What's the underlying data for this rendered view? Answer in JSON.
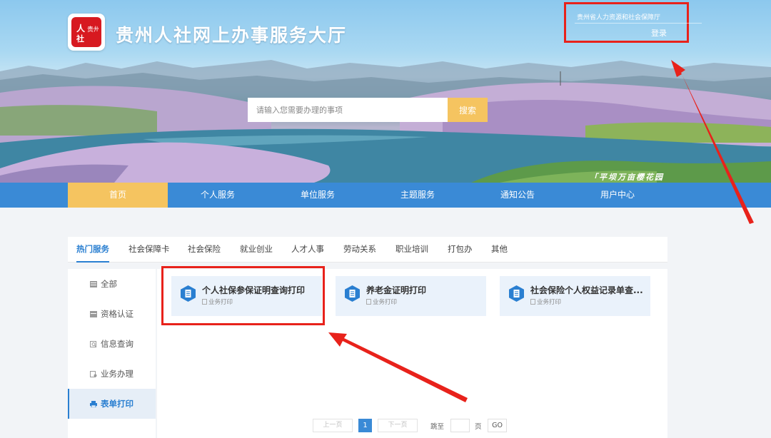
{
  "header": {
    "logo_text": "贵州",
    "site_title": "贵州人社网上办事服务大厅",
    "department": "贵州省人力资源和社会保障厅",
    "login_label": "登录",
    "scenic_label": "「平坝万亩樱花园"
  },
  "search": {
    "placeholder": "请输入您需要办理的事项",
    "button_label": "搜索"
  },
  "nav": {
    "items": [
      {
        "label": "首页",
        "active": true
      },
      {
        "label": "个人服务"
      },
      {
        "label": "单位服务"
      },
      {
        "label": "主题服务"
      },
      {
        "label": "通知公告"
      },
      {
        "label": "用户中心"
      }
    ]
  },
  "tabs": [
    {
      "label": "热门服务",
      "active": true
    },
    {
      "label": "社会保障卡"
    },
    {
      "label": "社会保险"
    },
    {
      "label": "就业创业"
    },
    {
      "label": "人才人事"
    },
    {
      "label": "劳动关系"
    },
    {
      "label": "职业培训"
    },
    {
      "label": "打包办"
    },
    {
      "label": "其他"
    }
  ],
  "sidebar": {
    "items": [
      {
        "label": "全部",
        "icon": "list-icon"
      },
      {
        "label": "资格认证",
        "icon": "card-icon"
      },
      {
        "label": "信息查询",
        "icon": "search-doc-icon"
      },
      {
        "label": "业务办理",
        "icon": "gear-doc-icon"
      },
      {
        "label": "表单打印",
        "icon": "printer-icon",
        "active": true
      }
    ]
  },
  "cards": [
    {
      "title": "个人社保参保证明查询打印",
      "tag": "业务打印"
    },
    {
      "title": "养老金证明打印",
      "tag": "业务打印"
    },
    {
      "title": "社会保险个人权益记录单查...",
      "tag": "业务打印"
    }
  ],
  "pagination": {
    "prev_label": "上一页",
    "current_page": "1",
    "next_label": "下一页",
    "jump_label": "跳至",
    "page_unit": "页",
    "go_label": "GO"
  },
  "colors": {
    "primary_blue": "#3a8ad6",
    "accent_yellow": "#f5c460",
    "annotation_red": "#e8221b",
    "card_bg": "#eaf2fb"
  }
}
